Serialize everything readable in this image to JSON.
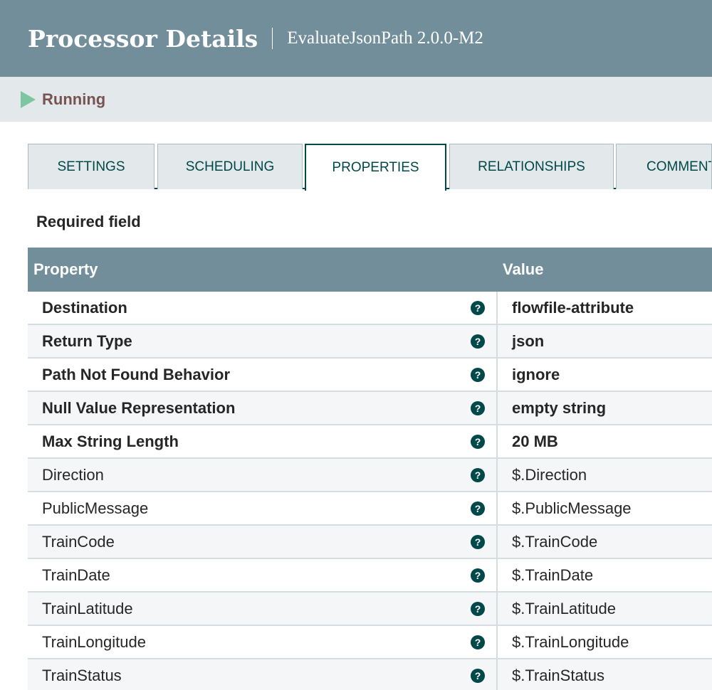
{
  "header": {
    "title": "Processor Details",
    "subtitle": "EvaluateJsonPath 2.0.0-M2"
  },
  "status": {
    "label": "Running",
    "icon": "play-icon"
  },
  "tabs": [
    {
      "label": "SETTINGS",
      "active": false
    },
    {
      "label": "SCHEDULING",
      "active": false
    },
    {
      "label": "PROPERTIES",
      "active": true
    },
    {
      "label": "RELATIONSHIPS",
      "active": false
    },
    {
      "label": "COMMENT",
      "active": false
    }
  ],
  "required_label": "Required field",
  "table": {
    "columns": [
      "Property",
      "Value"
    ],
    "help_icon_glyph": "?",
    "rows": [
      {
        "name": "Destination",
        "value": "flowfile-attribute",
        "required": true
      },
      {
        "name": "Return Type",
        "value": "json",
        "required": true
      },
      {
        "name": "Path Not Found Behavior",
        "value": "ignore",
        "required": true
      },
      {
        "name": "Null Value Representation",
        "value": "empty string",
        "required": true
      },
      {
        "name": "Max String Length",
        "value": "20 MB",
        "required": true
      },
      {
        "name": "Direction",
        "value": "$.Direction",
        "required": false
      },
      {
        "name": "PublicMessage",
        "value": "$.PublicMessage",
        "required": false
      },
      {
        "name": "TrainCode",
        "value": "$.TrainCode",
        "required": false
      },
      {
        "name": "TrainDate",
        "value": "$.TrainDate",
        "required": false
      },
      {
        "name": "TrainLatitude",
        "value": "$.TrainLatitude",
        "required": false
      },
      {
        "name": "TrainLongitude",
        "value": "$.TrainLongitude",
        "required": false
      },
      {
        "name": "TrainStatus",
        "value": "$.TrainStatus",
        "required": false
      }
    ]
  },
  "colors": {
    "header_bg": "#728e9b",
    "status_bg": "#e3e8eb",
    "running_icon": "#7dc7a0",
    "running_text": "#775351",
    "accent": "#004849"
  }
}
